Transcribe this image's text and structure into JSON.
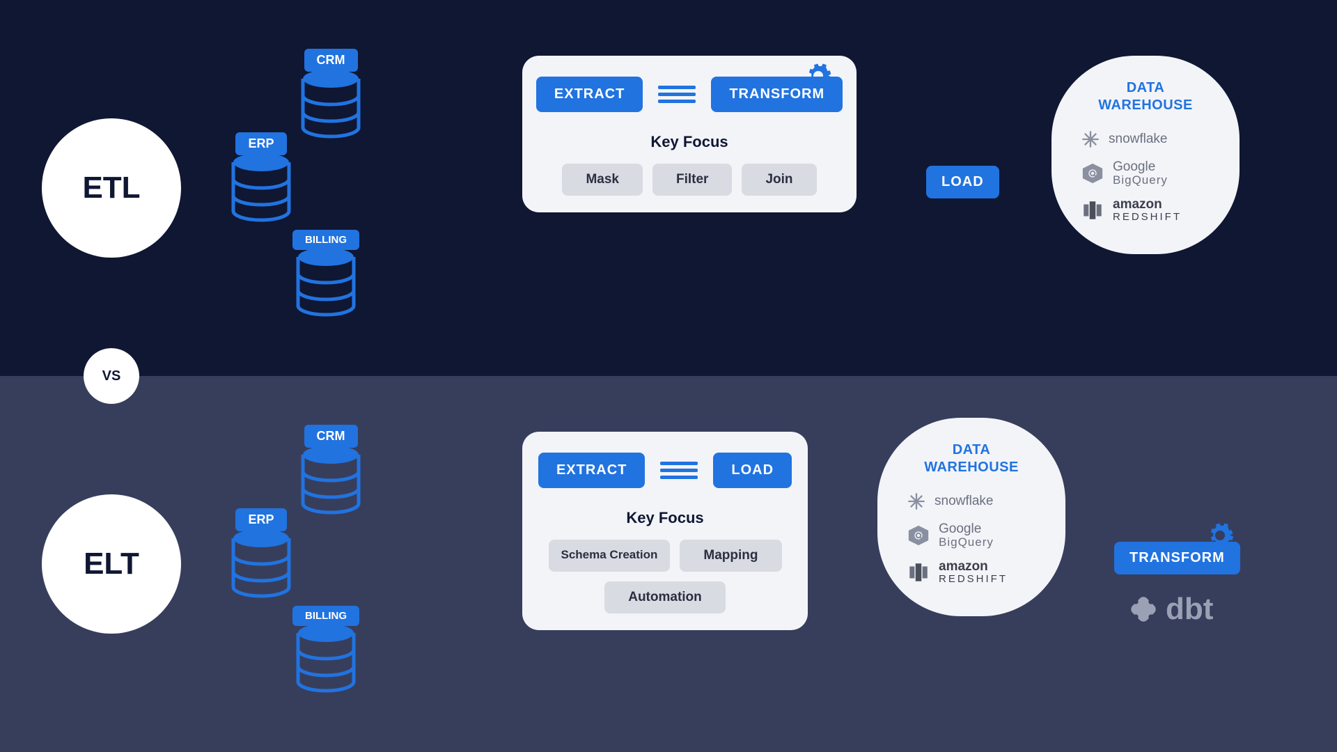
{
  "compare_label": "VS",
  "etl": {
    "label": "ETL",
    "sources": [
      "CRM",
      "ERP",
      "BILLING"
    ],
    "panel": {
      "pills": [
        "EXTRACT",
        "TRANSFORM"
      ],
      "gear_on_index": 1,
      "key_focus_title": "Key Focus",
      "chips": [
        "Mask",
        "Filter",
        "Join"
      ]
    },
    "after_panel_pill": "LOAD",
    "warehouse": {
      "title_line1": "DATA",
      "title_line2": "WAREHOUSE",
      "vendors": [
        {
          "name": "snowflake",
          "icon": "snowflake-icon"
        },
        {
          "name": "Google",
          "sub": "BigQuery",
          "icon": "bigquery-icon"
        },
        {
          "name": "amazon",
          "sub": "REDSHIFT",
          "icon": "redshift-icon"
        }
      ]
    }
  },
  "elt": {
    "label": "ELT",
    "sources": [
      "CRM",
      "ERP",
      "BILLING"
    ],
    "panel": {
      "pills": [
        "EXTRACT",
        "LOAD"
      ],
      "gear_on_index": -1,
      "key_focus_title": "Key Focus",
      "chips": [
        "Schema Creation",
        "Mapping",
        "Automation"
      ]
    },
    "warehouse": {
      "title_line1": "DATA",
      "title_line2": "WAREHOUSE",
      "vendors": [
        {
          "name": "snowflake",
          "icon": "snowflake-icon"
        },
        {
          "name": "Google",
          "sub": "BigQuery",
          "icon": "bigquery-icon"
        },
        {
          "name": "amazon",
          "sub": "REDSHIFT",
          "icon": "redshift-icon"
        }
      ]
    },
    "after_warehouse_pill": "TRANSFORM",
    "tool_label": "dbt"
  }
}
